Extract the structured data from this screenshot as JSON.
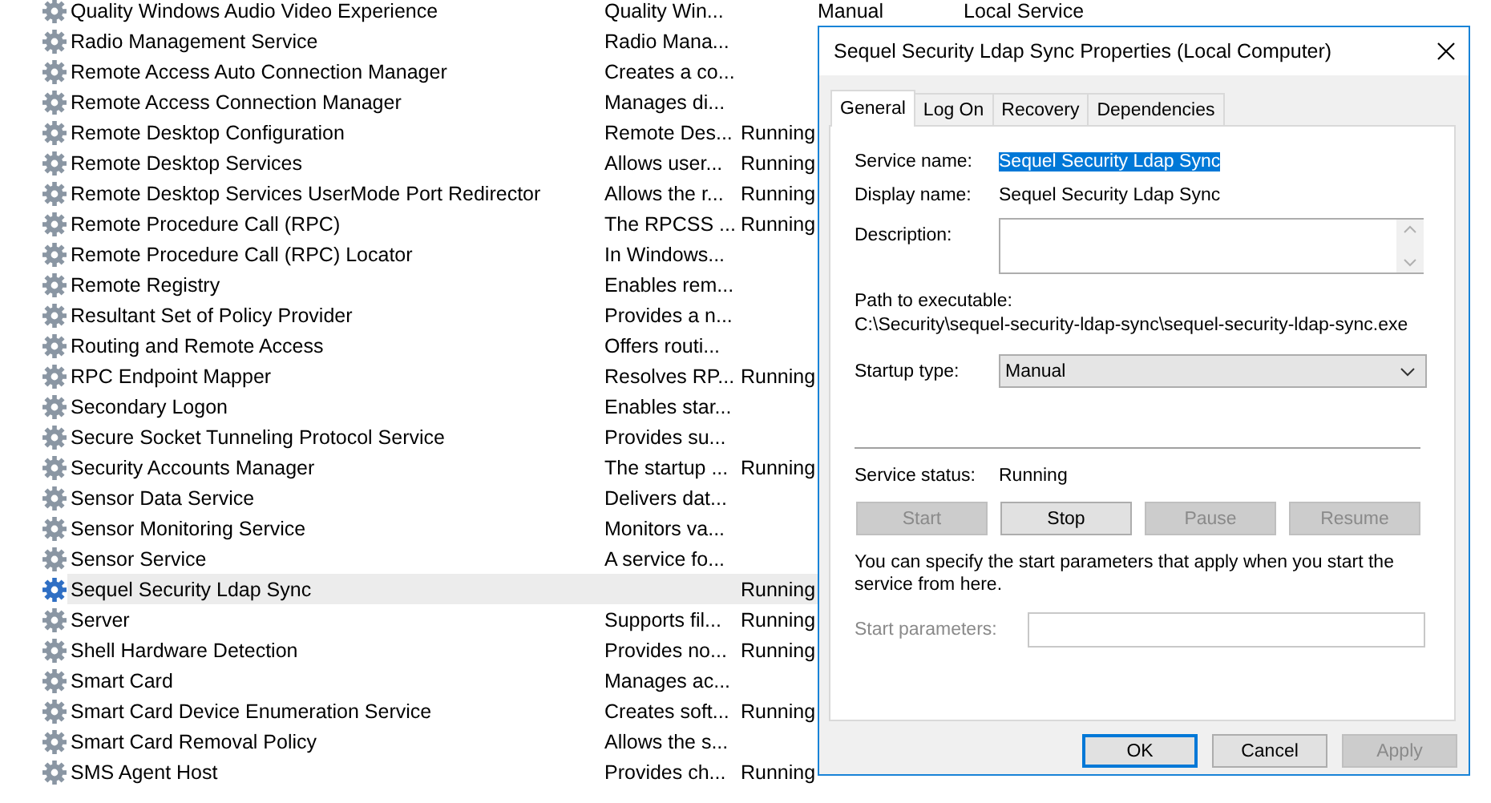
{
  "services": {
    "rows": [
      {
        "name": "Quality Windows Audio Video Experience",
        "description": "Quality Win...",
        "status": "",
        "startup_type": "Manual",
        "log_on_as": "Local Service",
        "selected": false
      },
      {
        "name": "Radio Management Service",
        "description": "Radio Mana...",
        "selected": false
      },
      {
        "name": "Remote Access Auto Connection Manager",
        "description": "Creates a co...",
        "selected": false
      },
      {
        "name": "Remote Access Connection Manager",
        "description": "Manages di...",
        "selected": false
      },
      {
        "name": "Remote Desktop Configuration",
        "description": "Remote Des...",
        "status": "Running",
        "selected": false
      },
      {
        "name": "Remote Desktop Services",
        "description": "Allows user...",
        "status": "Running",
        "selected": false
      },
      {
        "name": "Remote Desktop Services UserMode Port Redirector",
        "description": "Allows the r...",
        "status": "Running",
        "selected": false
      },
      {
        "name": "Remote Procedure Call (RPC)",
        "description": "The RPCSS ...",
        "status": "Running",
        "selected": false
      },
      {
        "name": "Remote Procedure Call (RPC) Locator",
        "description": "In Windows...",
        "selected": false
      },
      {
        "name": "Remote Registry",
        "description": "Enables rem...",
        "selected": false
      },
      {
        "name": "Resultant Set of Policy Provider",
        "description": "Provides a n...",
        "selected": false
      },
      {
        "name": "Routing and Remote Access",
        "description": "Offers routi...",
        "selected": false
      },
      {
        "name": "RPC Endpoint Mapper",
        "description": "Resolves RP...",
        "status": "Running",
        "selected": false
      },
      {
        "name": "Secondary Logon",
        "description": "Enables star...",
        "selected": false
      },
      {
        "name": "Secure Socket Tunneling Protocol Service",
        "description": "Provides su...",
        "selected": false
      },
      {
        "name": "Security Accounts Manager",
        "description": "The startup ...",
        "status": "Running",
        "selected": false
      },
      {
        "name": "Sensor Data Service",
        "description": "Delivers dat...",
        "selected": false
      },
      {
        "name": "Sensor Monitoring Service",
        "description": "Monitors va...",
        "selected": false
      },
      {
        "name": "Sensor Service",
        "description": "A service fo...",
        "selected": false
      },
      {
        "name": "Sequel Security Ldap Sync",
        "status": "Running",
        "selected": true
      },
      {
        "name": "Server",
        "description": "Supports fil...",
        "status": "Running",
        "selected": false
      },
      {
        "name": "Shell Hardware Detection",
        "description": "Provides no...",
        "status": "Running",
        "selected": false
      },
      {
        "name": "Smart Card",
        "description": "Manages ac...",
        "selected": false
      },
      {
        "name": "Smart Card Device Enumeration Service",
        "description": "Creates soft...",
        "status": "Running",
        "selected": false
      },
      {
        "name": "Smart Card Removal Policy",
        "description": "Allows the s...",
        "selected": false
      },
      {
        "name": "SMS Agent Host",
        "description": "Provides ch...",
        "status": "Running",
        "selected": false
      }
    ]
  },
  "dialog": {
    "title": "Sequel Security Ldap Sync Properties (Local Computer)",
    "tabs": [
      {
        "label": "General",
        "selected": true
      },
      {
        "label": "Log On",
        "selected": false
      },
      {
        "label": "Recovery",
        "selected": false
      },
      {
        "label": "Dependencies",
        "selected": false
      }
    ],
    "service_name": {
      "label": "Service name:",
      "value": "Sequel Security Ldap Sync",
      "selected": true
    },
    "display_name": {
      "label": "Display name:",
      "value": "Sequel Security Ldap Sync"
    },
    "description": {
      "label": "Description:"
    },
    "path": {
      "label": "Path to executable:",
      "value": "C:\\Security\\sequel-security-ldap-sync\\sequel-security-ldap-sync.exe"
    },
    "startup_type": {
      "label": "Startup type:",
      "value": "Manual"
    },
    "service_status": {
      "label": "Service status:",
      "value": "Running"
    },
    "control_buttons": [
      {
        "label": "Start",
        "disabled": true
      },
      {
        "label": "Stop",
        "disabled": false
      },
      {
        "label": "Pause",
        "disabled": true
      },
      {
        "label": "Resume",
        "disabled": true
      }
    ],
    "hint": "You can specify the start parameters that apply when you start the service from here.",
    "start_parameters": {
      "label": "Start parameters:",
      "disabled": true
    },
    "footer_buttons": [
      {
        "label": "OK",
        "disabled": false,
        "default": true
      },
      {
        "label": "Cancel",
        "disabled": false,
        "default": false
      },
      {
        "label": "Apply",
        "disabled": true,
        "default": false
      }
    ]
  }
}
